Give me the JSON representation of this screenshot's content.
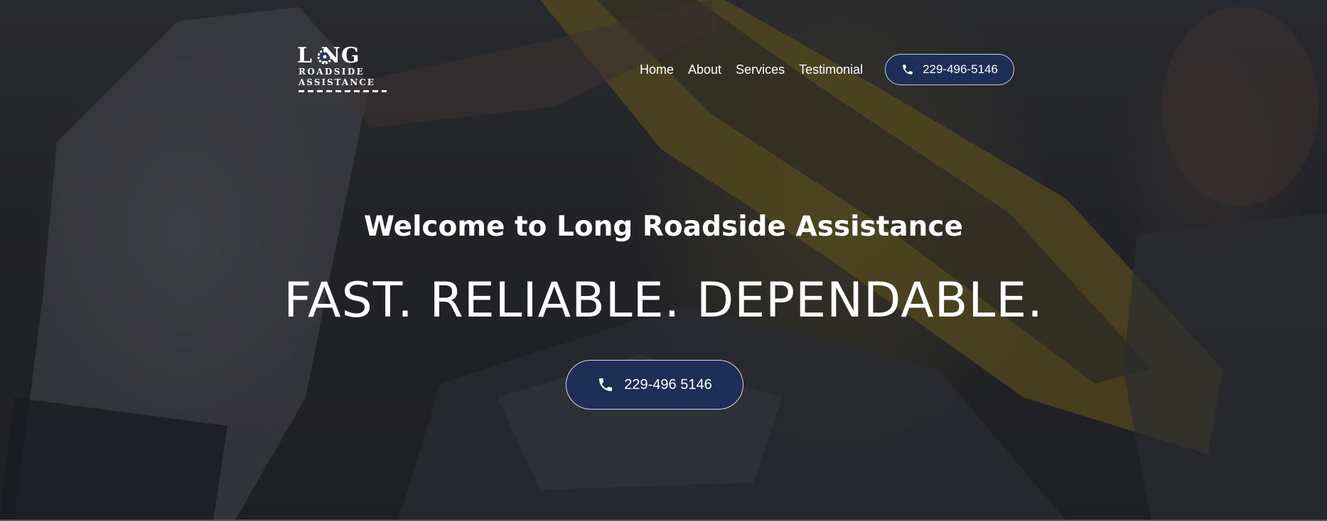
{
  "logo": {
    "word": "L NG",
    "line1": "ROADSIDE",
    "line2": "ASSISTANCE"
  },
  "nav": {
    "items": [
      {
        "label": "Home"
      },
      {
        "label": "About"
      },
      {
        "label": "Services"
      },
      {
        "label": "Testimonial"
      }
    ]
  },
  "header": {
    "phone_label": "229-496-5146",
    "phone_icon": "phone-icon"
  },
  "hero": {
    "welcome": "Welcome to Long Roadside Assistance",
    "tagline": "FAST. RELIABLE. DEPENDABLE.",
    "cta_label": "229-496 5146",
    "cta_icon": "phone-icon"
  },
  "colors": {
    "button_bg": "#1d2f56",
    "button_border": "#c9cfd9",
    "text": "#ffffff",
    "hood_yellow": "#c9a21e"
  }
}
